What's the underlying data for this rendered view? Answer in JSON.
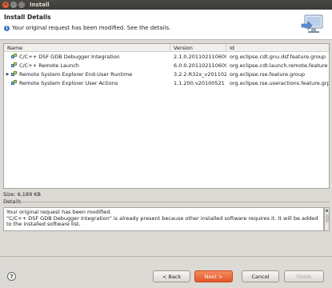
{
  "window": {
    "title": "Install"
  },
  "header": {
    "title": "Install Details",
    "message": "Your original request has been modified.  See the details."
  },
  "table": {
    "columns": [
      "Name",
      "Version",
      "Id"
    ],
    "rows": [
      {
        "name": "C/C++ DSF GDB Debugger Integration",
        "version": "2.1.0.201102110609",
        "id": "org.eclipse.cdt.gnu.dsf.feature.group",
        "expandable": false
      },
      {
        "name": "C/C++ Remote Launch",
        "version": "6.0.0.201102110609",
        "id": "org.eclipse.cdt.launch.remote.feature",
        "expandable": false
      },
      {
        "name": "Remote System Explorer End-User Runtime",
        "version": "3.2.2.R32x_v201102",
        "id": "org.eclipse.rse.feature.group",
        "expandable": true
      },
      {
        "name": "Remote System Explorer User Actions",
        "version": "1.1.200.v20100521",
        "id": "org.eclipse.rse.useractions.feature.grp",
        "expandable": false
      }
    ]
  },
  "size": "Size: 6,189 KB",
  "details": {
    "label": "Details",
    "line1": "Your original request has been modified.",
    "line2": "\"C/C++ DSF GDB Debugger Integration\" is already present because other installed software requires it.  It will be added",
    "line3": "to the installed software list."
  },
  "buttons": {
    "help": "?",
    "back": "< Back",
    "next": "Next >",
    "cancel": "Cancel",
    "finish": "Finish"
  }
}
